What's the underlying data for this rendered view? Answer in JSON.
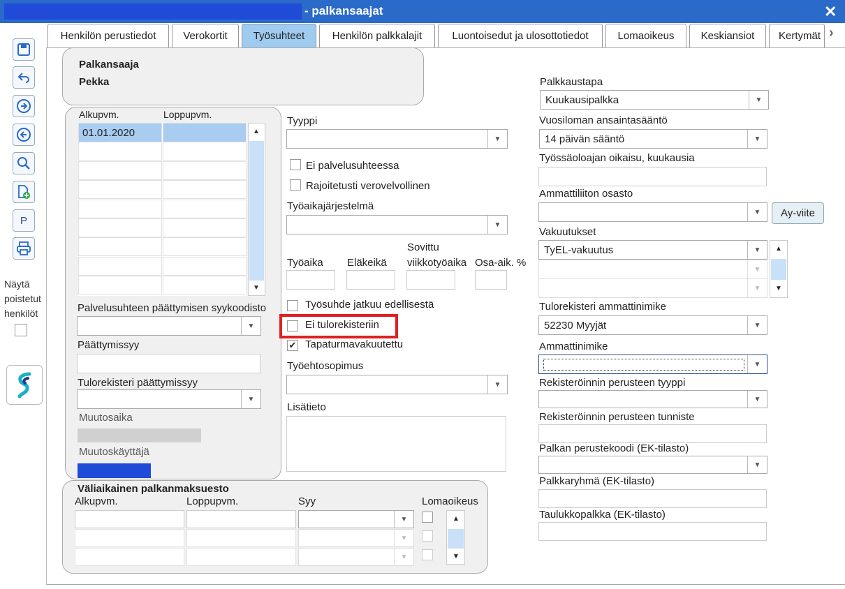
{
  "window": {
    "title": "- palkansaajat",
    "close_label": "✕"
  },
  "toolbar": {
    "p_label": "P"
  },
  "left": {
    "show_deleted_line1": "Näytä",
    "show_deleted_line2": "poistetut",
    "show_deleted_line3": "henkilöt"
  },
  "tabs": [
    {
      "label": "Henkilön perustiedot"
    },
    {
      "label": "Verokortit"
    },
    {
      "label": "Työsuhteet"
    },
    {
      "label": "Henkilön palkkalajit"
    },
    {
      "label": "Luontoisedut ja ulosottotiedot"
    },
    {
      "label": "Lomaoikeus"
    },
    {
      "label": "Keskiansiot"
    },
    {
      "label": "Kertymät"
    }
  ],
  "header": {
    "role": "Palkansaaja",
    "name": "Pekka"
  },
  "employment": {
    "col_start": "Alkupvm.",
    "col_end": "Loppupvm.",
    "rows": [
      {
        "start": "01.01.2020",
        "end": ""
      }
    ],
    "end_reason_code_label": "Palvelusuhteen päättymisen syykoodisto",
    "end_reason_label": "Päättymissyy",
    "ir_end_reason_label": "Tulorekisteri päättymissyy",
    "modified_time_label": "Muutosaika",
    "modified_user_label": "Muutoskäyttäjä"
  },
  "middle": {
    "type_label": "Tyyppi",
    "cb_not_employed": "Ei palvelusuhteessa",
    "cb_limited_tax": "Rajoitetusti verovelvollinen",
    "worktime_system_label": "Työaikajärjestelmä",
    "worktime_label": "Työaika",
    "retirement_age_label": "Eläkeikä",
    "agreed_hours_label1": "Sovittu",
    "agreed_hours_label2": "viikkotyöaika",
    "parttime_label": "Osa-aik. %",
    "cb_continues": "Työsuhde jatkuu edellisestä",
    "cb_no_income_register": "Ei tulorekisteriin",
    "cb_accident_insured": "Tapaturmavakuutettu",
    "collective_agreement_label": "Työehtosopimus",
    "additional_info_label": "Lisätieto"
  },
  "right": {
    "pay_method_label": "Palkkaustapa",
    "pay_method_value": "Kuukausipalkka",
    "holiday_rule_label": "Vuosiloman ansaintasääntö",
    "holiday_rule_value": "14 päivän sääntö",
    "holiday_adjust_label": "Työssäoloajan oikaisu, kuukausia",
    "union_label": "Ammattiliiton osasto",
    "ay_button": "Ay-viite",
    "insurance_label": "Vakuutukset",
    "insurance_value": "TyEL-vakuutus",
    "ir_occupation_label": "Tulorekisteri ammattinimike",
    "ir_occupation_value": "52230 Myyjät",
    "occupation_label": "Ammattinimike",
    "reg_basis_type_label": "Rekisteröinnin perusteen tyyppi",
    "reg_basis_id_label": "Rekisteröinnin perusteen tunniste",
    "pay_code_label": "Palkan perustekoodi (EK-tilasto)",
    "pay_group_label": "Palkkaryhmä (EK-tilasto)",
    "table_pay_label": "Taulukkopalkka (EK-tilasto)"
  },
  "temp": {
    "title": "Väliaikainen palkanmaksuesto",
    "col_start": "Alkupvm.",
    "col_end": "Loppupvm.",
    "col_reason": "Syy",
    "col_holiday": "Lomaoikeus"
  },
  "colors": {
    "titlebar": "#2a6ac9",
    "active_tab": "#9ecbef",
    "highlight": "#e02020"
  }
}
